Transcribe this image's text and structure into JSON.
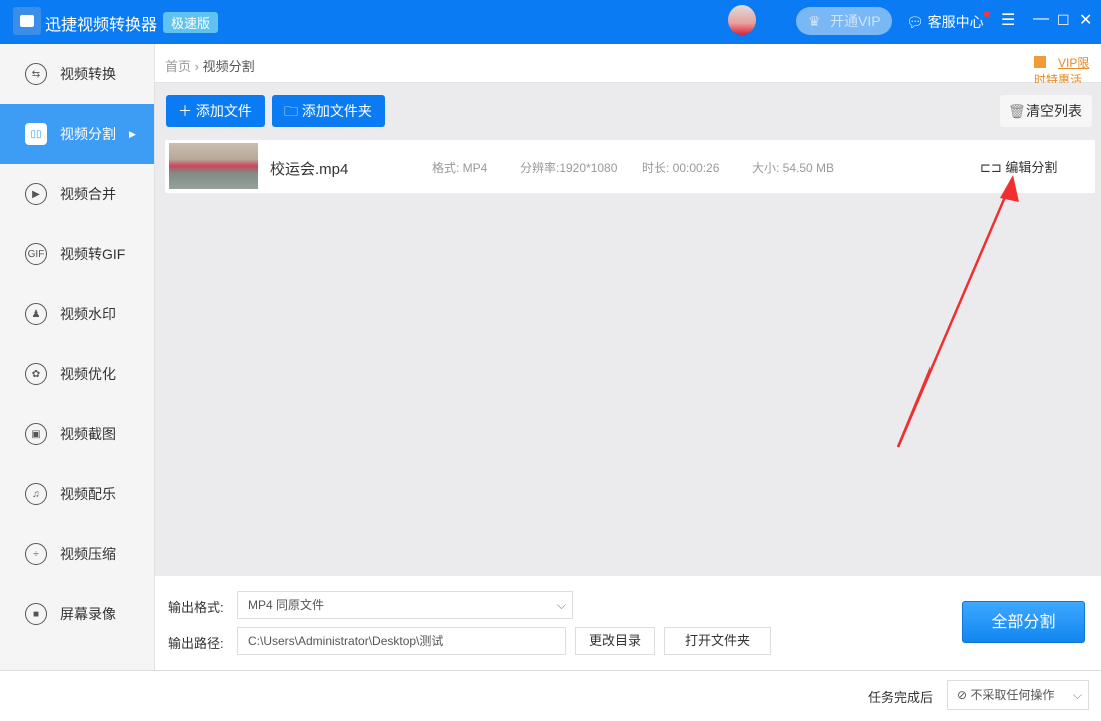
{
  "app": {
    "title": "迅捷视频转换器",
    "edition_badge": "极速版",
    "vip_button": "开通VIP",
    "service": "客服中心"
  },
  "sidebar": {
    "items": [
      {
        "label": "视频转换",
        "icon": "⇆"
      },
      {
        "label": "视频分割",
        "icon": "▯▯"
      },
      {
        "label": "视频合并",
        "icon": "▶"
      },
      {
        "label": "视频转GIF",
        "icon": "GIF"
      },
      {
        "label": "视频水印",
        "icon": "♟"
      },
      {
        "label": "视频优化",
        "icon": "✿"
      },
      {
        "label": "视频截图",
        "icon": "▣"
      },
      {
        "label": "视频配乐",
        "icon": "♫"
      },
      {
        "label": "视频压缩",
        "icon": "÷"
      },
      {
        "label": "屏幕录像",
        "icon": "■"
      }
    ],
    "active": 1
  },
  "breadcrumb": {
    "home": "首页",
    "current": "视频分割"
  },
  "promo": "VIP限时特惠活动，即将恢复原价",
  "toolbar": {
    "add_file": "添加文件",
    "add_folder": "添加文件夹",
    "clear_list": "清空列表"
  },
  "files": [
    {
      "name": "校运会.mp4",
      "format": "格式: MP4",
      "resolution": "分辨率:1920*1080",
      "duration": "时长: 00:00:26",
      "size": "大小: 54.50 MB",
      "action": "编辑分割"
    }
  ],
  "output": {
    "format_label": "输出格式:",
    "format_value": "MP4  同原文件",
    "path_label": "输出路径:",
    "path_value": "C:\\Users\\Administrator\\Desktop\\测试",
    "change_dir": "更改目录",
    "open_folder": "打开文件夹",
    "split_all": "全部分割"
  },
  "footer": {
    "after_task_label": "任务完成后",
    "after_task_value": "不采取任何操作"
  },
  "colors": {
    "primary": "#0a7bf2",
    "promo": "#e8891f",
    "annotation": "#f03030"
  }
}
